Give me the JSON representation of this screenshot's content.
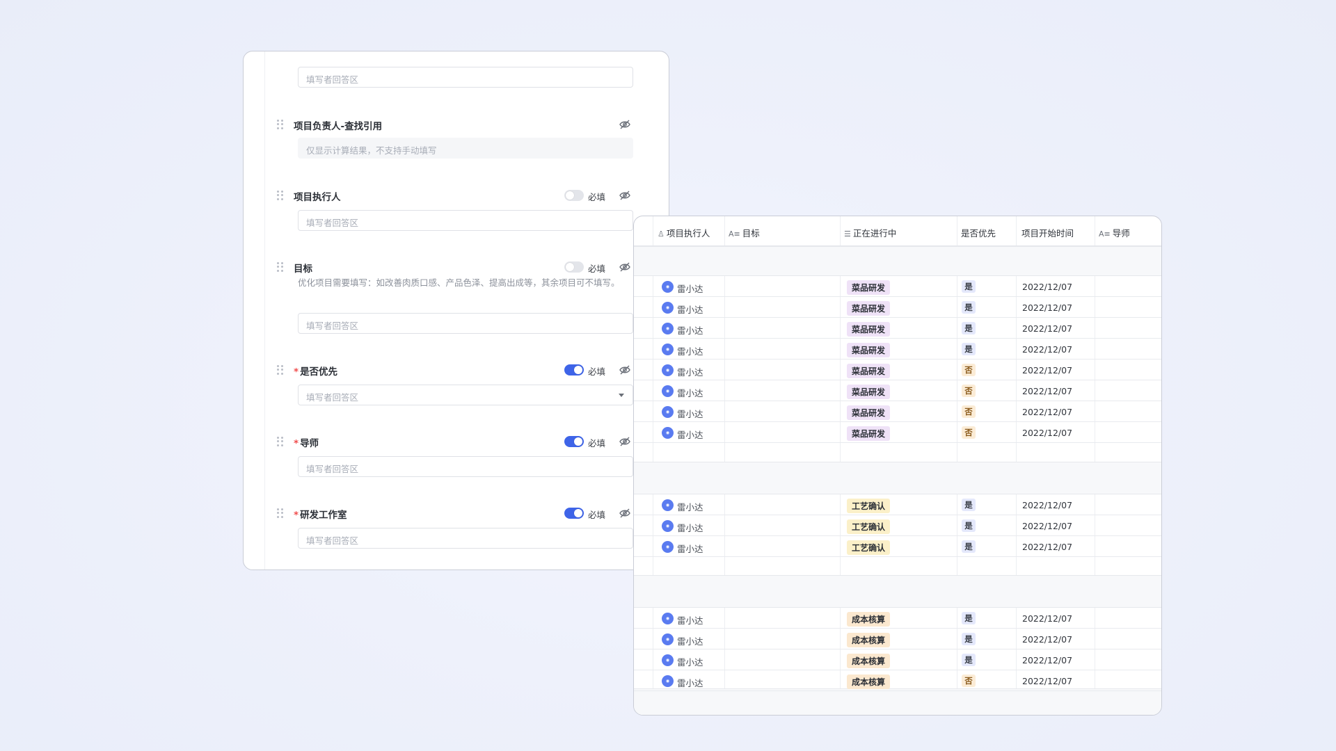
{
  "form": {
    "fields": [
      {
        "label": "项目负责人-查找引用",
        "required_star": false,
        "show_toggle": false,
        "toggle_on": false,
        "answer": "仅显示计算结果，不支持手动填写",
        "readonly": true
      },
      {
        "label": "项目执行人",
        "required_star": false,
        "show_toggle": true,
        "toggle_on": false,
        "required_text": "必填",
        "answer": "填写者回答区"
      },
      {
        "label": "目标",
        "required_star": false,
        "show_toggle": true,
        "toggle_on": false,
        "required_text": "必填",
        "description": "优化项目需要填写：如改善肉质口感、产品色泽、提高出成等，其余项目可不填写。",
        "answer": "填写者回答区"
      },
      {
        "label": "是否优先",
        "required_star": true,
        "show_toggle": true,
        "toggle_on": true,
        "required_text": "必填",
        "answer": "填写者回答区",
        "dropdown": true
      },
      {
        "label": "导师",
        "required_star": true,
        "show_toggle": true,
        "toggle_on": true,
        "required_text": "必填",
        "answer": "填写者回答区"
      },
      {
        "label": "研发工作室",
        "required_star": true,
        "show_toggle": true,
        "toggle_on": true,
        "required_text": "必填",
        "answer": "填写者回答区"
      }
    ],
    "top_answer": "填写者回答区",
    "star": "*"
  },
  "table": {
    "headers": {
      "executor": "项目执行人",
      "goal": "目标",
      "status": "正在进行中",
      "priority": "是否优先",
      "start_time": "项目开始时间",
      "mentor": "导师"
    },
    "groups": [
      {
        "rows": [
          {
            "person": "雷小达",
            "tag": "菜品研发",
            "tag_color": "purple",
            "priority": "是",
            "date": "2022/12/07"
          },
          {
            "person": "雷小达",
            "tag": "菜品研发",
            "tag_color": "purple",
            "priority": "是",
            "date": "2022/12/07"
          },
          {
            "person": "雷小达",
            "tag": "菜品研发",
            "tag_color": "purple",
            "priority": "是",
            "date": "2022/12/07"
          },
          {
            "person": "雷小达",
            "tag": "菜品研发",
            "tag_color": "purple",
            "priority": "是",
            "date": "2022/12/07"
          },
          {
            "person": "雷小达",
            "tag": "菜品研发",
            "tag_color": "purple",
            "priority": "否",
            "date": "2022/12/07"
          },
          {
            "person": "雷小达",
            "tag": "菜品研发",
            "tag_color": "purple",
            "priority": "否",
            "date": "2022/12/07"
          },
          {
            "person": "雷小达",
            "tag": "菜品研发",
            "tag_color": "purple",
            "priority": "否",
            "date": "2022/12/07"
          },
          {
            "person": "雷小达",
            "tag": "菜品研发",
            "tag_color": "purple",
            "priority": "否",
            "date": "2022/12/07"
          }
        ]
      },
      {
        "rows": [
          {
            "person": "雷小达",
            "tag": "工艺确认",
            "tag_color": "yellow",
            "priority": "是",
            "date": "2022/12/07"
          },
          {
            "person": "雷小达",
            "tag": "工艺确认",
            "tag_color": "yellow",
            "priority": "是",
            "date": "2022/12/07"
          },
          {
            "person": "雷小达",
            "tag": "工艺确认",
            "tag_color": "yellow",
            "priority": "是",
            "date": "2022/12/07"
          }
        ]
      },
      {
        "rows": [
          {
            "person": "雷小达",
            "tag": "成本核算",
            "tag_color": "orange",
            "priority": "是",
            "date": "2022/12/07"
          },
          {
            "person": "雷小达",
            "tag": "成本核算",
            "tag_color": "orange",
            "priority": "是",
            "date": "2022/12/07"
          },
          {
            "person": "雷小达",
            "tag": "成本核算",
            "tag_color": "orange",
            "priority": "是",
            "date": "2022/12/07"
          },
          {
            "person": "雷小达",
            "tag": "成本核算",
            "tag_color": "orange",
            "priority": "否",
            "date": "2022/12/07"
          }
        ]
      }
    ]
  }
}
